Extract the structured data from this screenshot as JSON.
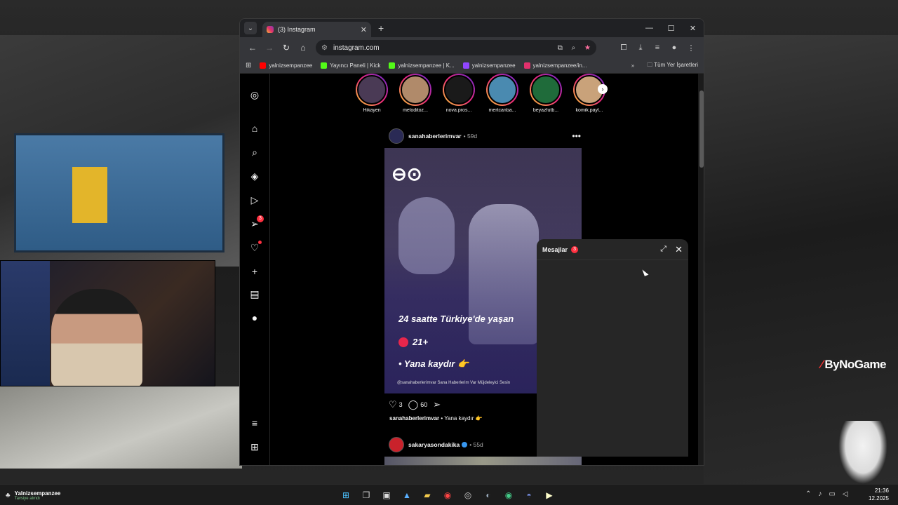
{
  "browser": {
    "tab_title": "(3) Instagram",
    "url": "instagram.com",
    "bookmarks": [
      {
        "label": "yalnizsempanzee",
        "color": "#ff0000"
      },
      {
        "label": "Yayıncı Paneli | Kick",
        "color": "#53fc18"
      },
      {
        "label": "yalnizsempanzee | K...",
        "color": "#53fc18"
      },
      {
        "label": "yalnizsempanzee",
        "color": "#9146ff"
      },
      {
        "label": "yalnizsempanzee/in...",
        "color": "#e1306c"
      }
    ],
    "bookmarks_folder": "Tüm Yer İşaretleri"
  },
  "instagram": {
    "rail": {
      "messages_badge": "3"
    },
    "stories": [
      {
        "name": "Hikayen",
        "color": "#4a3a55"
      },
      {
        "name": "melodi̇toz...",
        "color": "#b08a6a"
      },
      {
        "name": "nova.pros...",
        "color": "#1a1a1a"
      },
      {
        "name": "mertcanba...",
        "color": "#4a8ab0"
      },
      {
        "name": "beyazfutb...",
        "color": "#1f6b3a"
      },
      {
        "name": "komik.payl...",
        "color": "#c9a27a"
      }
    ],
    "post1": {
      "user": "sanahaberlerimvar",
      "time": "• 59d",
      "line1": "24 saatte Türkiye'de yaşan",
      "line2": "21+",
      "line3": "• Yana kaydır 👉",
      "footer": "@sanahaberlerimvar  Sana Haberlerim Var  Müjdeleyici Sesin",
      "likes": "3",
      "comments": "60",
      "caption_user": "sanahaberlerimvar",
      "caption_text": "• Yana kaydır 👉"
    },
    "post2": {
      "user": "sakaryasondakika",
      "time": "• 55d"
    },
    "dm": {
      "title": "Mesajlar",
      "badge": "3"
    }
  },
  "overlay": {
    "brand": "ByNoGame"
  },
  "taskbar": {
    "user_name": "Yalnizsempanzee",
    "user_status": "Tavsiye alındı",
    "time": "21:36",
    "date": "12.2025"
  }
}
